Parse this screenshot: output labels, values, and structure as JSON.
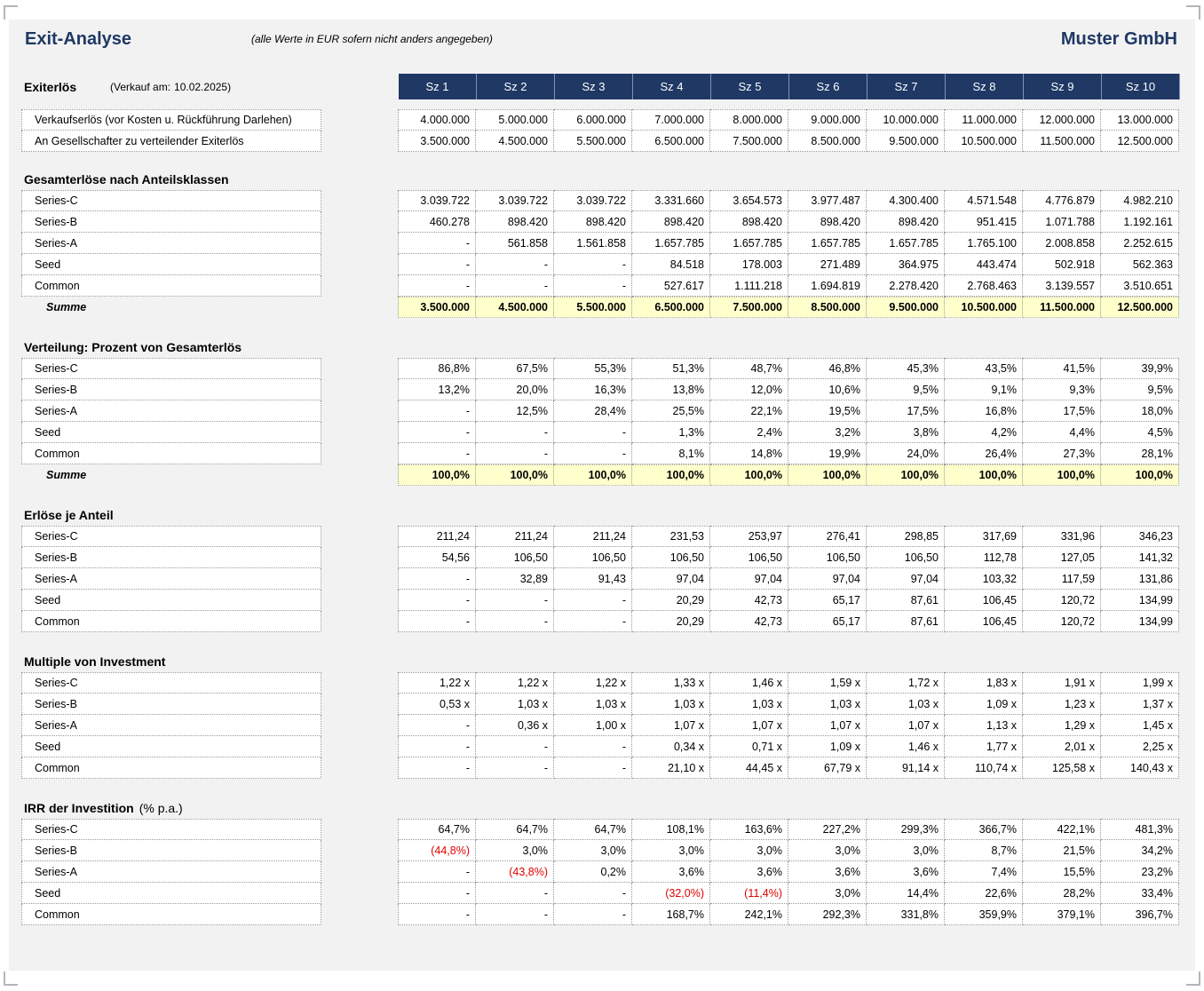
{
  "header": {
    "title": "Exit-Analyse",
    "subtitle": "(alle Werte in EUR sofern nicht anders angegeben)",
    "company": "Muster GmbH"
  },
  "exit": {
    "label": "Exiterlös",
    "date_prefix": "(Verkauf am:",
    "date_value": "10.02.2025)"
  },
  "scenarios": [
    "Sz 1",
    "Sz 2",
    "Sz 3",
    "Sz 4",
    "Sz 5",
    "Sz 6",
    "Sz 7",
    "Sz 8",
    "Sz 9",
    "Sz 10"
  ],
  "sections": [
    {
      "title": "",
      "rows": [
        {
          "label": "Verkaufserlös (vor Kosten u. Rückführung Darlehen)",
          "values": [
            "4.000.000",
            "5.000.000",
            "6.000.000",
            "7.000.000",
            "8.000.000",
            "9.000.000",
            "10.000.000",
            "11.000.000",
            "12.000.000",
            "13.000.000"
          ]
        },
        {
          "label": "An Gesellschafter zu verteilender Exiterlös",
          "values": [
            "3.500.000",
            "4.500.000",
            "5.500.000",
            "6.500.000",
            "7.500.000",
            "8.500.000",
            "9.500.000",
            "10.500.000",
            "11.500.000",
            "12.500.000"
          ]
        }
      ]
    },
    {
      "title": "Gesamterlöse nach Anteilsklassen",
      "rows": [
        {
          "label": "Series-C",
          "values": [
            "3.039.722",
            "3.039.722",
            "3.039.722",
            "3.331.660",
            "3.654.573",
            "3.977.487",
            "4.300.400",
            "4.571.548",
            "4.776.879",
            "4.982.210"
          ]
        },
        {
          "label": "Series-B",
          "values": [
            "460.278",
            "898.420",
            "898.420",
            "898.420",
            "898.420",
            "898.420",
            "898.420",
            "951.415",
            "1.071.788",
            "1.192.161"
          ]
        },
        {
          "label": "Series-A",
          "values": [
            "-",
            "561.858",
            "1.561.858",
            "1.657.785",
            "1.657.785",
            "1.657.785",
            "1.657.785",
            "1.765.100",
            "2.008.858",
            "2.252.615"
          ]
        },
        {
          "label": "Seed",
          "values": [
            "-",
            "-",
            "-",
            "84.518",
            "178.003",
            "271.489",
            "364.975",
            "443.474",
            "502.918",
            "562.363"
          ]
        },
        {
          "label": "Common",
          "values": [
            "-",
            "-",
            "-",
            "527.617",
            "1.111.218",
            "1.694.819",
            "2.278.420",
            "2.768.463",
            "3.139.557",
            "3.510.651"
          ]
        }
      ],
      "sum": {
        "label": "Summe",
        "values": [
          "3.500.000",
          "4.500.000",
          "5.500.000",
          "6.500.000",
          "7.500.000",
          "8.500.000",
          "9.500.000",
          "10.500.000",
          "11.500.000",
          "12.500.000"
        ]
      }
    },
    {
      "title": "Verteilung: Prozent von Gesamterlös",
      "rows": [
        {
          "label": "Series-C",
          "values": [
            "86,8%",
            "67,5%",
            "55,3%",
            "51,3%",
            "48,7%",
            "46,8%",
            "45,3%",
            "43,5%",
            "41,5%",
            "39,9%"
          ]
        },
        {
          "label": "Series-B",
          "values": [
            "13,2%",
            "20,0%",
            "16,3%",
            "13,8%",
            "12,0%",
            "10,6%",
            "9,5%",
            "9,1%",
            "9,3%",
            "9,5%"
          ]
        },
        {
          "label": "Series-A",
          "values": [
            "-",
            "12,5%",
            "28,4%",
            "25,5%",
            "22,1%",
            "19,5%",
            "17,5%",
            "16,8%",
            "17,5%",
            "18,0%"
          ]
        },
        {
          "label": "Seed",
          "values": [
            "-",
            "-",
            "-",
            "1,3%",
            "2,4%",
            "3,2%",
            "3,8%",
            "4,2%",
            "4,4%",
            "4,5%"
          ]
        },
        {
          "label": "Common",
          "values": [
            "-",
            "-",
            "-",
            "8,1%",
            "14,8%",
            "19,9%",
            "24,0%",
            "26,4%",
            "27,3%",
            "28,1%"
          ]
        }
      ],
      "sum": {
        "label": "Summe",
        "values": [
          "100,0%",
          "100,0%",
          "100,0%",
          "100,0%",
          "100,0%",
          "100,0%",
          "100,0%",
          "100,0%",
          "100,0%",
          "100,0%"
        ]
      }
    },
    {
      "title": "Erlöse je Anteil",
      "rows": [
        {
          "label": "Series-C",
          "values": [
            "211,24",
            "211,24",
            "211,24",
            "231,53",
            "253,97",
            "276,41",
            "298,85",
            "317,69",
            "331,96",
            "346,23"
          ]
        },
        {
          "label": "Series-B",
          "values": [
            "54,56",
            "106,50",
            "106,50",
            "106,50",
            "106,50",
            "106,50",
            "106,50",
            "112,78",
            "127,05",
            "141,32"
          ]
        },
        {
          "label": "Series-A",
          "values": [
            "-",
            "32,89",
            "91,43",
            "97,04",
            "97,04",
            "97,04",
            "97,04",
            "103,32",
            "117,59",
            "131,86"
          ]
        },
        {
          "label": "Seed",
          "values": [
            "-",
            "-",
            "-",
            "20,29",
            "42,73",
            "65,17",
            "87,61",
            "106,45",
            "120,72",
            "134,99"
          ]
        },
        {
          "label": "Common",
          "values": [
            "-",
            "-",
            "-",
            "20,29",
            "42,73",
            "65,17",
            "87,61",
            "106,45",
            "120,72",
            "134,99"
          ]
        }
      ]
    },
    {
      "title": "Multiple von Investment",
      "rows": [
        {
          "label": "Series-C",
          "values": [
            "1,22 x",
            "1,22 x",
            "1,22 x",
            "1,33 x",
            "1,46 x",
            "1,59 x",
            "1,72 x",
            "1,83 x",
            "1,91 x",
            "1,99 x"
          ]
        },
        {
          "label": "Series-B",
          "values": [
            "0,53 x",
            "1,03 x",
            "1,03 x",
            "1,03 x",
            "1,03 x",
            "1,03 x",
            "1,03 x",
            "1,09 x",
            "1,23 x",
            "1,37 x"
          ]
        },
        {
          "label": "Series-A",
          "values": [
            "-",
            "0,36 x",
            "1,00 x",
            "1,07 x",
            "1,07 x",
            "1,07 x",
            "1,07 x",
            "1,13 x",
            "1,29 x",
            "1,45 x"
          ]
        },
        {
          "label": "Seed",
          "values": [
            "-",
            "-",
            "-",
            "0,34 x",
            "0,71 x",
            "1,09 x",
            "1,46 x",
            "1,77 x",
            "2,01 x",
            "2,25 x"
          ]
        },
        {
          "label": "Common",
          "values": [
            "-",
            "-",
            "-",
            "21,10 x",
            "44,45 x",
            "67,79 x",
            "91,14 x",
            "110,74 x",
            "125,58 x",
            "140,43 x"
          ]
        }
      ]
    },
    {
      "title": "IRR der Investition",
      "note": "(% p.a.)",
      "rows": [
        {
          "label": "Series-C",
          "values": [
            "64,7%",
            "64,7%",
            "64,7%",
            "108,1%",
            "163,6%",
            "227,2%",
            "299,3%",
            "366,7%",
            "422,1%",
            "481,3%"
          ]
        },
        {
          "label": "Series-B",
          "values": [
            "(44,8%)",
            "3,0%",
            "3,0%",
            "3,0%",
            "3,0%",
            "3,0%",
            "3,0%",
            "8,7%",
            "21,5%",
            "34,2%"
          ]
        },
        {
          "label": "Series-A",
          "values": [
            "-",
            "(43,8%)",
            "0,2%",
            "3,6%",
            "3,6%",
            "3,6%",
            "3,6%",
            "7,4%",
            "15,5%",
            "23,2%"
          ]
        },
        {
          "label": "Seed",
          "values": [
            "-",
            "-",
            "-",
            "(32,0%)",
            "(11,4%)",
            "3,0%",
            "14,4%",
            "22,6%",
            "28,2%",
            "33,4%"
          ]
        },
        {
          "label": "Common",
          "values": [
            "-",
            "-",
            "-",
            "168,7%",
            "242,1%",
            "292,3%",
            "331,8%",
            "359,9%",
            "379,1%",
            "396,7%"
          ]
        }
      ]
    }
  ],
  "colors": {
    "header_navy": "#1f3864",
    "sheet_bg": "#f2f2f2",
    "sum_highlight": "#ffffcc",
    "negative": "#e00000"
  }
}
